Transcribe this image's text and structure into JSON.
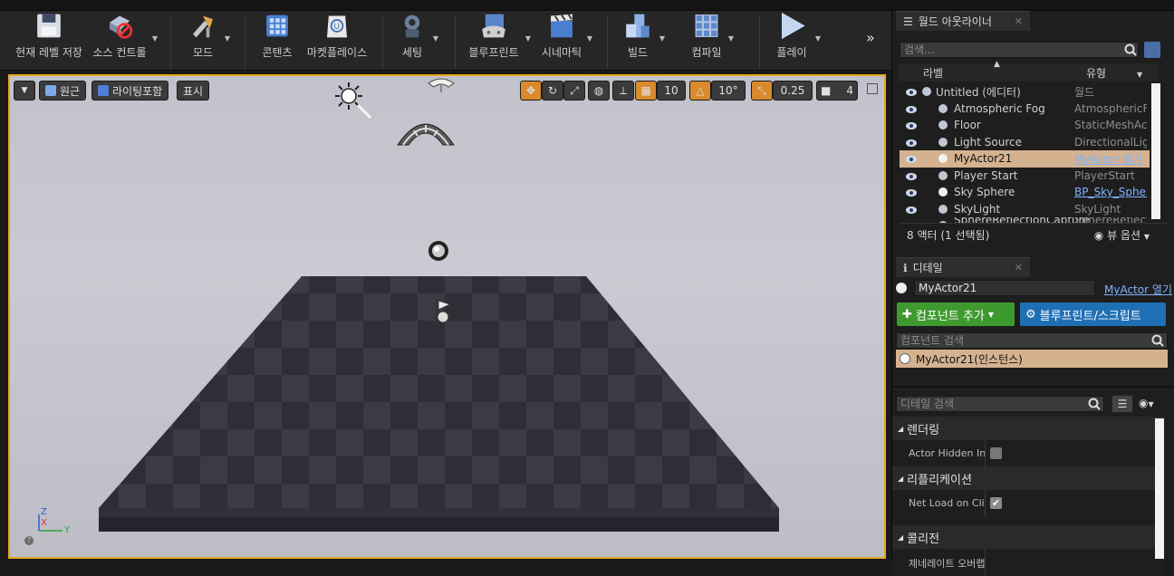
{
  "toolbar": {
    "save_current_level": "현재 레벨 저장",
    "source_control": "소스 컨트롤",
    "modes": "모드",
    "content": "콘텐츠",
    "marketplace": "마켓플레이스",
    "settings": "세팅",
    "blueprints": "블루프린트",
    "cinematics": "시네마틱",
    "build": "빌드",
    "compile": "컴파일",
    "play": "플레이"
  },
  "viewport": {
    "perspective": "원근",
    "lighting": "라이팅포함",
    "show": "표시",
    "grid_snap": "10",
    "rotation_snap": "10°",
    "scale_snap": "0.25",
    "camera_speed": "4",
    "axis_z": "Z",
    "axis_x": "X",
    "axis_y": "Y",
    "help": "?"
  },
  "outliner": {
    "tab_title": "월드 아웃라이너",
    "search_placeholder": "검색...",
    "col_label": "라벨",
    "col_type": "유형",
    "rows": [
      {
        "name": "Untitled (에디터)",
        "type": "월드"
      },
      {
        "name": "Atmospheric Fog",
        "type": "AtmosphericFog"
      },
      {
        "name": "Floor",
        "type": "StaticMeshActor"
      },
      {
        "name": "Light Source",
        "type": "DirectionalLight"
      },
      {
        "name": "MyActor21",
        "type": "MyActor 열기"
      },
      {
        "name": "Player Start",
        "type": "PlayerStart"
      },
      {
        "name": "Sky Sphere",
        "type": "BP_Sky_Sphere"
      },
      {
        "name": "SkyLight",
        "type": "SkyLight"
      },
      {
        "name": "SphereReflectionCapture",
        "type": "SphereReflectionCapture"
      }
    ],
    "status": "8 액터 (1 선택됨)",
    "view_options": "뷰 옵션"
  },
  "details": {
    "tab_title": "디테일",
    "actor_name": "MyActor21",
    "actor_class_link": "MyActor 열기",
    "add_component": "컴포넌트 추가",
    "blueprint_script": "블루프린트/스크립트",
    "component_search_placeholder": "컴포넌트 검색",
    "instance_row": "MyActor21(인스턴스)",
    "details_search_placeholder": "디테일 검색",
    "cat_rendering": "렌더링",
    "prop_actor_hidden": "Actor Hidden In Game",
    "actor_hidden_checked": false,
    "cat_replication": "리플리케이션",
    "prop_net_load": "Net Load on Client",
    "net_load_checked": true,
    "cat_collision": "콜리전",
    "prop_collision_partial": "제네레이트 오버랩 이벤트"
  },
  "colors": {
    "accent_orange": "#e5a820",
    "selection": "#d4b290",
    "add_component_green": "#3e9a2f",
    "blueprint_blue": "#1f6fb5",
    "link_blue": "#7fb3ff"
  }
}
